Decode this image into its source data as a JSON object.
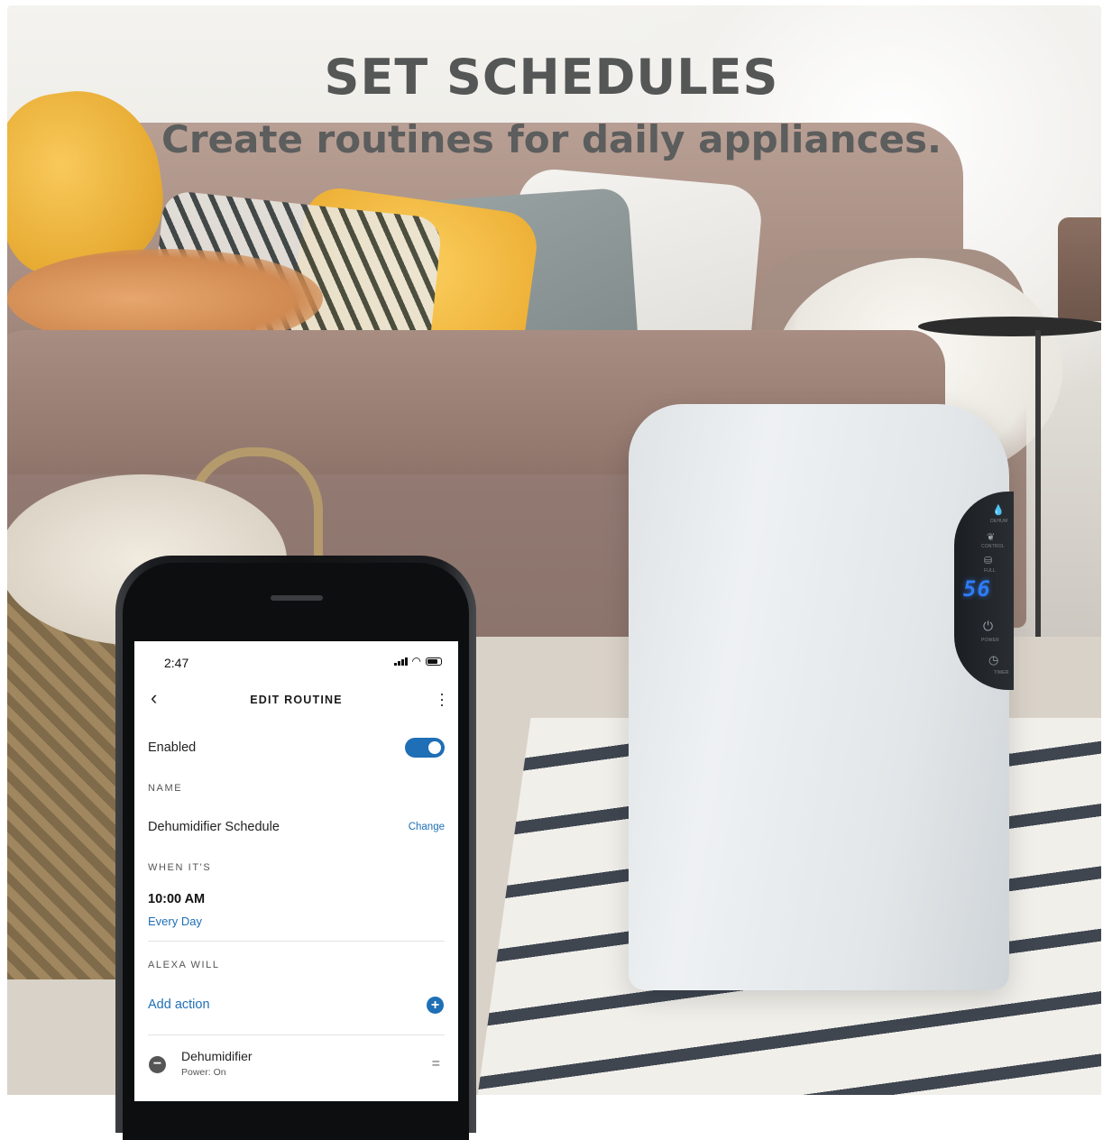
{
  "hero": {
    "headline": "SET SCHEDULES",
    "subline": "Create routines for daily appliances."
  },
  "device_panel": {
    "display_value": "56",
    "labels": [
      "DEHUM",
      "CONTROL",
      "FULL",
      "POWER",
      "TIMER"
    ]
  },
  "phone": {
    "status_bar": {
      "time": "2:47"
    },
    "header": {
      "title": "EDIT ROUTINE"
    },
    "enabled": {
      "label": "Enabled",
      "on": true
    },
    "name_section": {
      "heading": "NAME",
      "value": "Dehumidifier Schedule",
      "change_label": "Change"
    },
    "when_section": {
      "heading": "WHEN IT'S",
      "time": "10:00 AM",
      "repeat": "Every Day"
    },
    "alexa_section": {
      "heading": "ALEXA WILL",
      "add_action_label": "Add action"
    },
    "action_item": {
      "name": "Dehumidifier",
      "detail": "Power: On"
    }
  },
  "colors": {
    "accent": "#1e6fb5",
    "display_blue": "#2e7cf6",
    "heading_gray": "#555656"
  }
}
